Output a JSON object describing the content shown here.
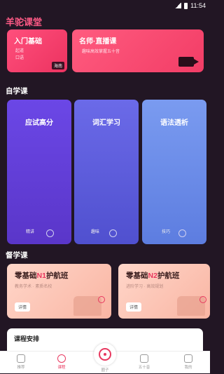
{
  "status": {
    "time": "11:54"
  },
  "app": {
    "title": "羊驼课堂"
  },
  "top_cards": [
    {
      "title": "入门基础",
      "lines": [
        "起道",
        "口语"
      ],
      "tag": "海南"
    },
    {
      "title": "名师·直播课",
      "subtitle": "趣味高效掌握五十音"
    }
  ],
  "sections": {
    "self_study": "自学课",
    "supervised": "督学课"
  },
  "self_courses": [
    {
      "title": "应试高分",
      "sub": "精讲"
    },
    {
      "title": "词汇学习",
      "sub": "趣味"
    },
    {
      "title": "语法透析",
      "sub": "技巧"
    }
  ],
  "supervised_courses": [
    {
      "title_pre": "零基础",
      "title_num": "N1",
      "title_post": "护航班",
      "sub": "教务学术 · 素质名校",
      "detail": "详情"
    },
    {
      "title_pre": "零基础",
      "title_num": "N2",
      "title_post": "护航班",
      "sub": "进阶学习 · 高效规划",
      "detail": "详情"
    }
  ],
  "schedule": {
    "title": "课程安排"
  },
  "tabs": [
    "推荐",
    "课程",
    "圈子",
    "五十音",
    "我的"
  ],
  "colors": {
    "accent": "#e8385f",
    "bg": "#221624"
  }
}
